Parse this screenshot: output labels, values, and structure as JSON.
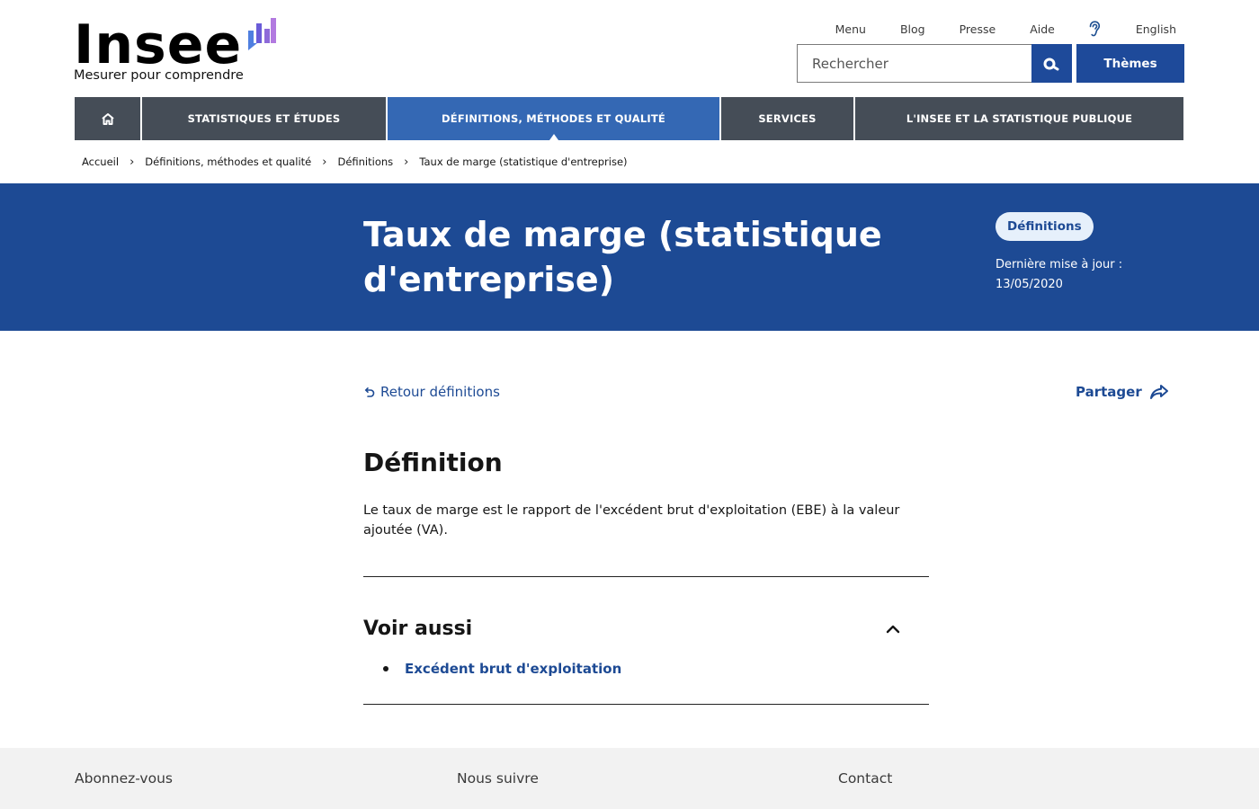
{
  "header": {
    "logo_word": "Insee",
    "logo_tagline": "Mesurer pour comprendre",
    "top_links": {
      "menu": "Menu",
      "blog": "Blog",
      "presse": "Presse",
      "aide": "Aide",
      "english": "English"
    },
    "search_placeholder": "Rechercher",
    "themes_label": "Thèmes",
    "brand_colors": [
      "#4f7fe0",
      "#6a5cd8",
      "#9b6ad6"
    ]
  },
  "nav": {
    "home_icon": "home-icon",
    "items": [
      "STATISTIQUES ET ÉTUDES",
      "DÉFINITIONS, MÉTHODES ET QUALITÉ",
      "SERVICES",
      "L'INSEE ET LA STATISTIQUE PUBLIQUE"
    ],
    "active_index": 1
  },
  "breadcrumb": [
    "Accueil",
    "Définitions, méthodes et qualité",
    "Définitions",
    "Taux de marge (statistique d'entreprise)"
  ],
  "banner": {
    "title": "Taux de marge (statistique d'entreprise)",
    "badge": "Définitions",
    "update_label": "Dernière mise à jour :",
    "update_date": "13/05/2020"
  },
  "content": {
    "back_label": "Retour définitions",
    "share_label": "Partager",
    "definition_heading": "Définition",
    "definition_text": "Le taux de marge est le rapport de l'excédent brut d'exploitation (EBE) à la valeur ajoutée (VA).",
    "see_also_heading": "Voir aussi",
    "see_also_links": [
      "Excédent brut d'exploitation"
    ]
  },
  "footer": {
    "col1": "Abonnez-vous",
    "col2": "Nous suivre",
    "col3": "Contact"
  }
}
